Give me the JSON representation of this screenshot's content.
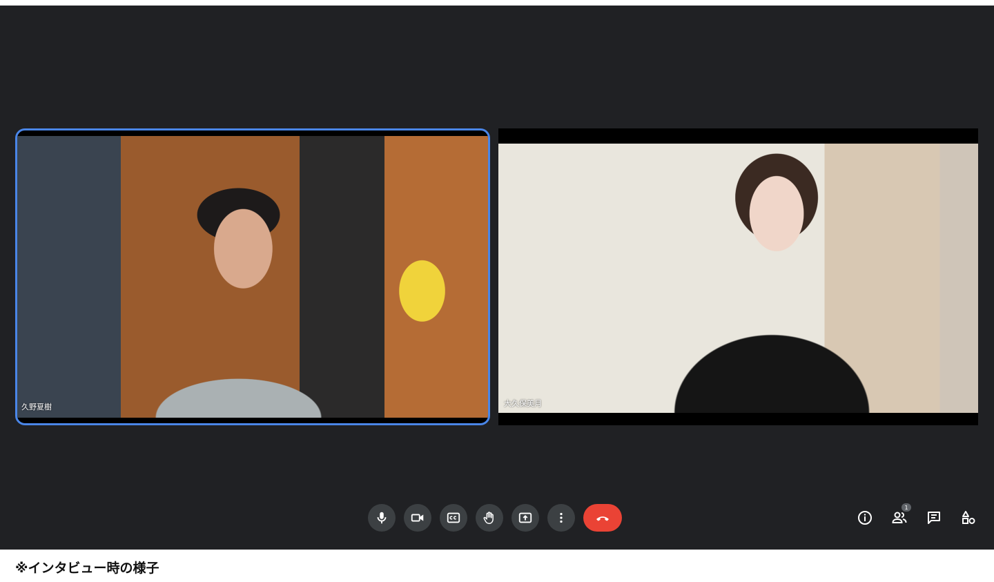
{
  "participants": [
    {
      "name": "久野夏樹",
      "active_speaker": true
    },
    {
      "name": "大久保美月",
      "active_speaker": false
    }
  ],
  "controls": {
    "items": [
      "microphone-icon",
      "camera-icon",
      "captions-icon",
      "raise-hand-icon",
      "present-screen-icon",
      "more-options-icon",
      "hang-up-icon"
    ]
  },
  "side_controls": {
    "items": [
      "meeting-info-icon",
      "people-icon",
      "chat-icon",
      "activities-icon"
    ],
    "people_count": "1"
  },
  "colors": {
    "meet_background": "#202124",
    "control_button": "#3c4043",
    "hangup": "#ea4335",
    "active_border": "#4a86e8"
  },
  "caption": "※インタビュー時の様子"
}
